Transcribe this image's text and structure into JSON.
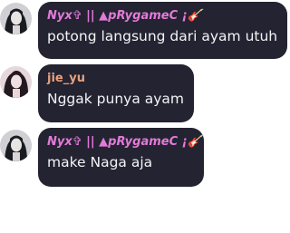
{
  "colors": {
    "bubble": "#232331",
    "nyx_name": "#e27ad8",
    "jie_name": "#e8a07e",
    "message_text": "#f3f3f7"
  },
  "messages": [
    {
      "sender": "Nyx✞ || ▲pRygameC ¡🎸",
      "text": "potong langsung dari ayam utuh",
      "avatar_icon": "user-avatar-icon"
    },
    {
      "sender": "jie_yu",
      "text": "Nggak punya ayam",
      "avatar_icon": "user-avatar-icon"
    },
    {
      "sender": "Nyx✞ || ▲pRygameC ¡🎸",
      "text": "make Naga aja",
      "avatar_icon": "user-avatar-icon"
    }
  ]
}
